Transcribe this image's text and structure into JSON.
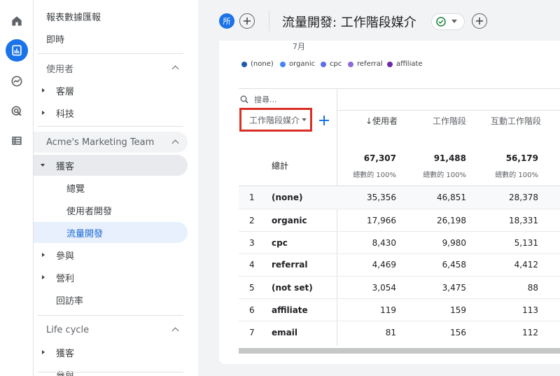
{
  "rail": {
    "icons": [
      "home-icon",
      "reports-icon",
      "explore-icon",
      "advertising-icon",
      "configure-icon"
    ]
  },
  "nav": {
    "reports_snapshot": "報表數據匯報",
    "realtime": "即時",
    "users_section": "使用者",
    "audience": "客層",
    "tech": "科技",
    "team_section": "Acme's Marketing Team",
    "acquisition": "獲客",
    "overview": "總覽",
    "user_acquisition": "使用者開發",
    "traffic_acquisition": "流量開發",
    "engagement": "參與",
    "monetization": "營利",
    "retention": "回訪率",
    "lifecycle_section": "Life cycle",
    "lifecycle_acquisition": "獲客",
    "cut_off_item": "參與"
  },
  "header": {
    "all_badge": "所",
    "title": "流量開發: 工作階段媒介"
  },
  "chart": {
    "axis_label": "7月",
    "legend": [
      {
        "label": "(none)",
        "color": "#1f5aa6"
      },
      {
        "label": "organic",
        "color": "#4285f4"
      },
      {
        "label": "cpc",
        "color": "#5b6ee8"
      },
      {
        "label": "referral",
        "color": "#8e6bd6"
      },
      {
        "label": "affiliate",
        "color": "#6a2aa8"
      }
    ]
  },
  "table": {
    "search_placeholder": "搜尋...",
    "dimension_label": "工作階段媒介",
    "columns": [
      "↓使用者",
      "工作階段",
      "互動工作階段"
    ],
    "total_label": "總計",
    "totals": [
      "67,307",
      "91,488",
      "56,179"
    ],
    "total_pct": [
      "總數的 100%",
      "總數的 100%",
      "總數的 100%"
    ],
    "rows": [
      {
        "idx": "1",
        "name": "(none)",
        "users": "35,356",
        "sessions": "46,851",
        "engaged": "28,378"
      },
      {
        "idx": "2",
        "name": "organic",
        "users": "17,966",
        "sessions": "26,198",
        "engaged": "18,331"
      },
      {
        "idx": "3",
        "name": "cpc",
        "users": "8,430",
        "sessions": "9,980",
        "engaged": "5,131"
      },
      {
        "idx": "4",
        "name": "referral",
        "users": "4,469",
        "sessions": "6,458",
        "engaged": "4,412"
      },
      {
        "idx": "5",
        "name": "(not set)",
        "users": "3,054",
        "sessions": "3,475",
        "engaged": "88"
      },
      {
        "idx": "6",
        "name": "affiliate",
        "users": "119",
        "sessions": "159",
        "engaged": "113"
      },
      {
        "idx": "7",
        "name": "email",
        "users": "81",
        "sessions": "156",
        "engaged": "112"
      }
    ]
  },
  "colors": {
    "accent": "#1a73e8",
    "highlight_box": "#d93025",
    "selected_nav_bg": "#e8f0fe"
  }
}
